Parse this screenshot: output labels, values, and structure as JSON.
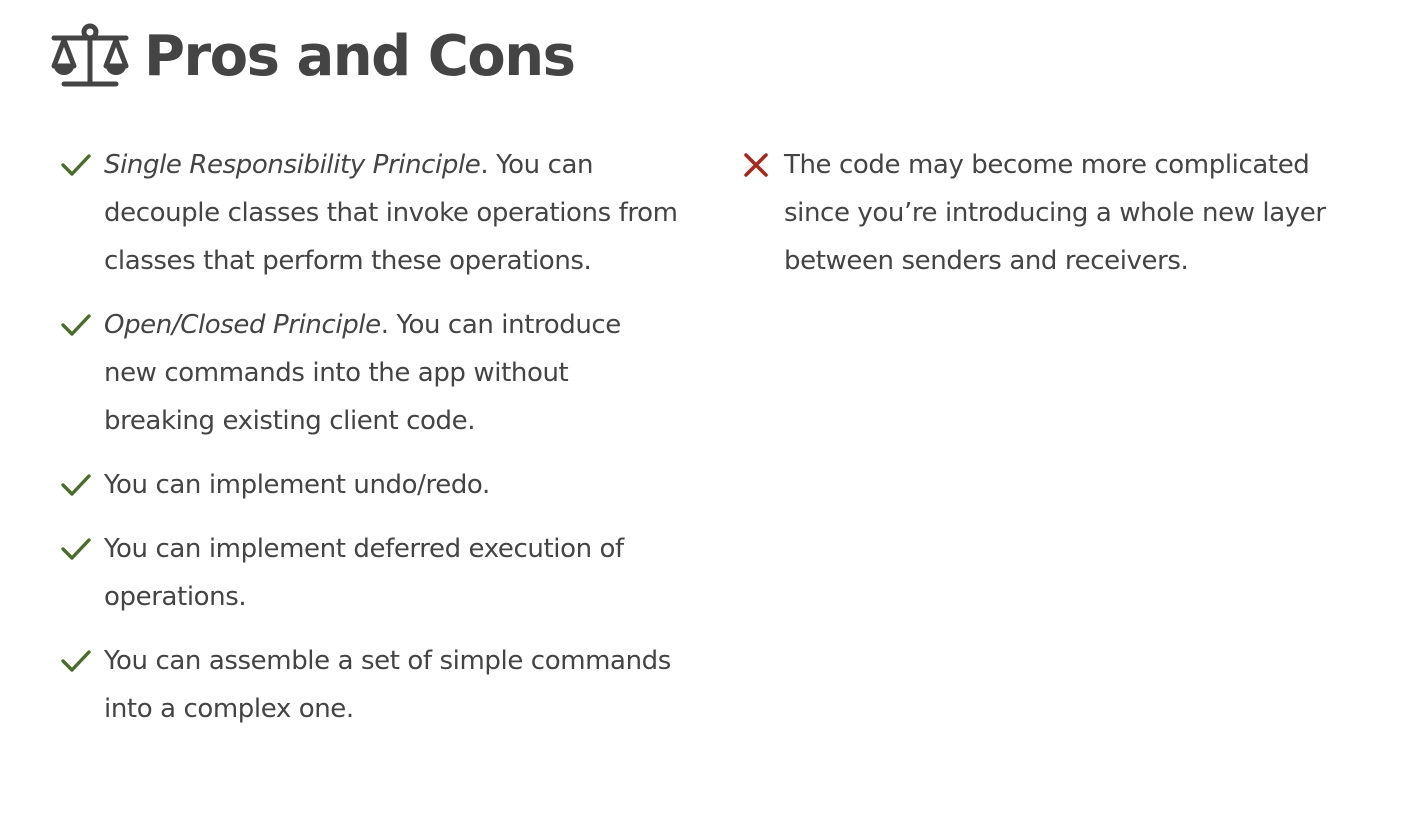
{
  "section": {
    "title": "Pros and Cons",
    "icon": "balance-scale-icon"
  },
  "colors": {
    "text": "#444444",
    "pro_check": "#4a6b2a",
    "con_cross": "#a8281e"
  },
  "pros": [
    {
      "principle": "Single Responsibility Principle",
      "text": ". You can decouple classes that invoke operations from classes that perform these operations."
    },
    {
      "principle": "Open/Closed Principle",
      "text": ". You can introduce new commands into the app without breaking existing client code."
    },
    {
      "principle": "",
      "text": "You can implement undo/redo."
    },
    {
      "principle": "",
      "text": "You can implement deferred execution of operations."
    },
    {
      "principle": "",
      "text": "You can assemble a set of simple commands into a complex one."
    }
  ],
  "cons": [
    {
      "text": "The code may become more complicated since you’re introducing a whole new layer between senders and receivers."
    }
  ]
}
